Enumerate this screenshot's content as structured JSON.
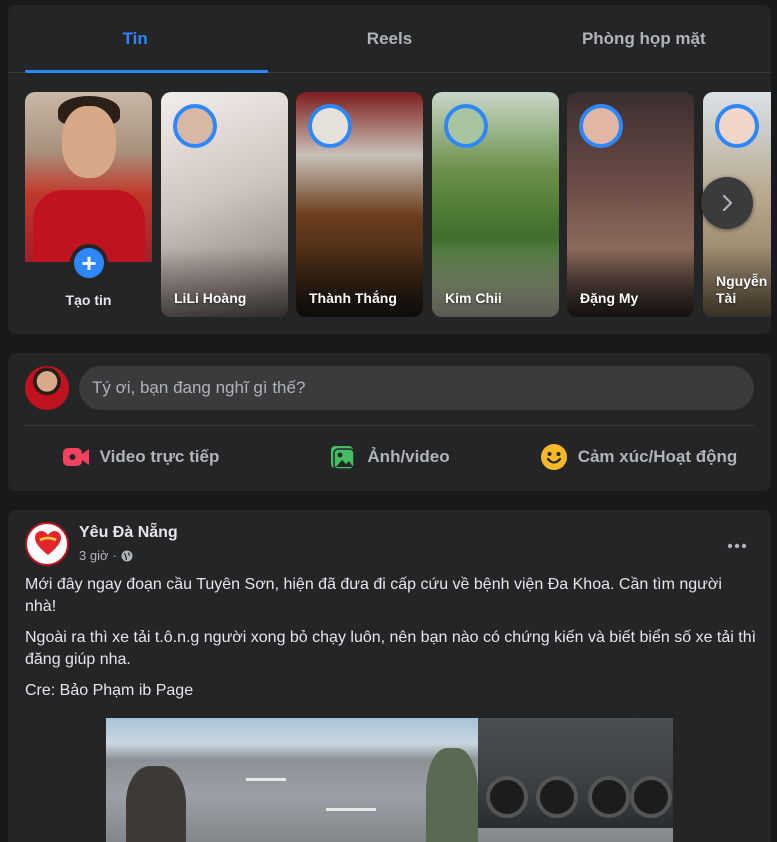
{
  "tabs": [
    {
      "label": "Tin",
      "active": true
    },
    {
      "label": "Reels",
      "active": false
    },
    {
      "label": "Phòng họp mặt",
      "active": false
    }
  ],
  "stories": {
    "create_label": "Tạo tin",
    "items": [
      {
        "name": "LiLi Hoàng"
      },
      {
        "name": "Thành Thắng"
      },
      {
        "name": "Kim Chii"
      },
      {
        "name": "Đặng My"
      },
      {
        "name": "Nguyễn Tài"
      }
    ]
  },
  "composer": {
    "placeholder": "Tý ơi, bạn đang nghĩ gì thế?",
    "actions": [
      {
        "label": "Video trực tiếp",
        "icon": "live-video-icon",
        "color": "#f3425f"
      },
      {
        "label": "Ảnh/video",
        "icon": "photo-video-icon",
        "color": "#45bd62"
      },
      {
        "label": "Cảm xúc/Hoạt động",
        "icon": "feeling-icon",
        "color": "#f7b928"
      }
    ]
  },
  "post": {
    "author": "Yêu Đà Nẵng",
    "time": "3 giờ",
    "separator": "·",
    "privacy_icon": "globe-icon",
    "paragraphs": [
      "Mới đây ngay đoạn cầu Tuyên Sơn, hiện đã đưa đi cấp cứu về bệnh viện Đa Khoa. Cần tìm người nhà!",
      "Ngoài ra thì xe tải t.ô.n.g người xong bỏ chạy luôn, nên bạn nào có chứng kiến và biết biển số xe tải thì đăng giúp nha.",
      "Cre: Bảo Phạm ib Page"
    ]
  },
  "colors": {
    "accent": "#2d88ff",
    "background": "#18191a",
    "card": "#242526"
  }
}
